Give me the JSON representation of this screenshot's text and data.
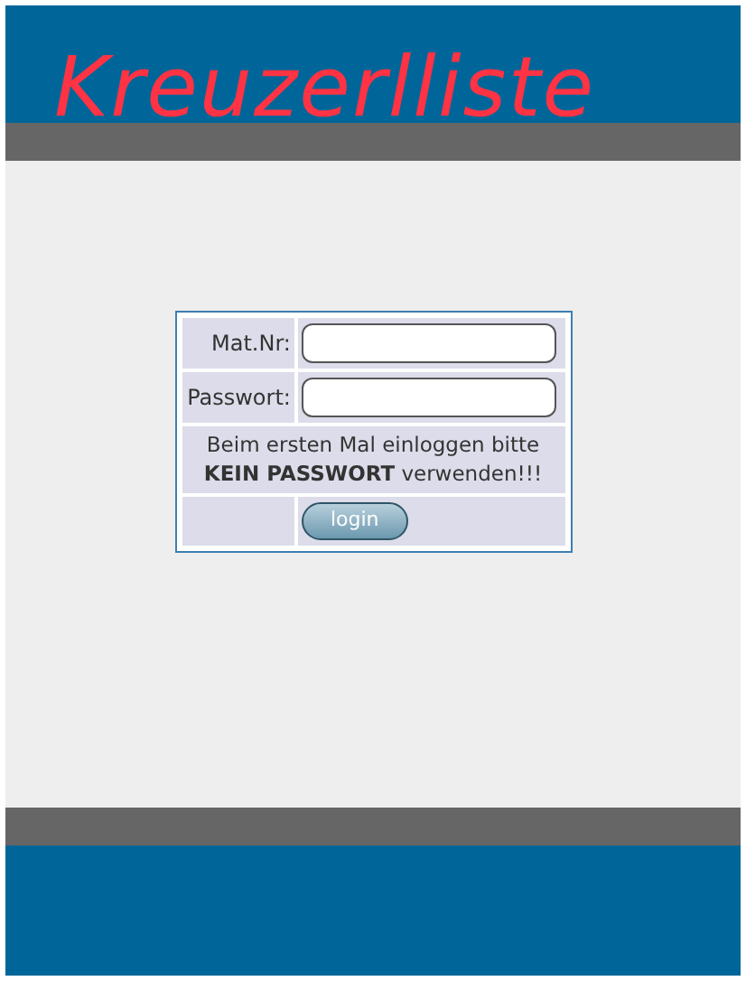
{
  "header": {
    "title": "Kreuzerlliste"
  },
  "login_form": {
    "fields": [
      {
        "label": "Mat.Nr:"
      },
      {
        "label": "Passwort:"
      }
    ],
    "notice": "Beim ersten Mal einloggen bitte **KEIN PASSWORT** verwenden!!!",
    "button": "login"
  }
}
